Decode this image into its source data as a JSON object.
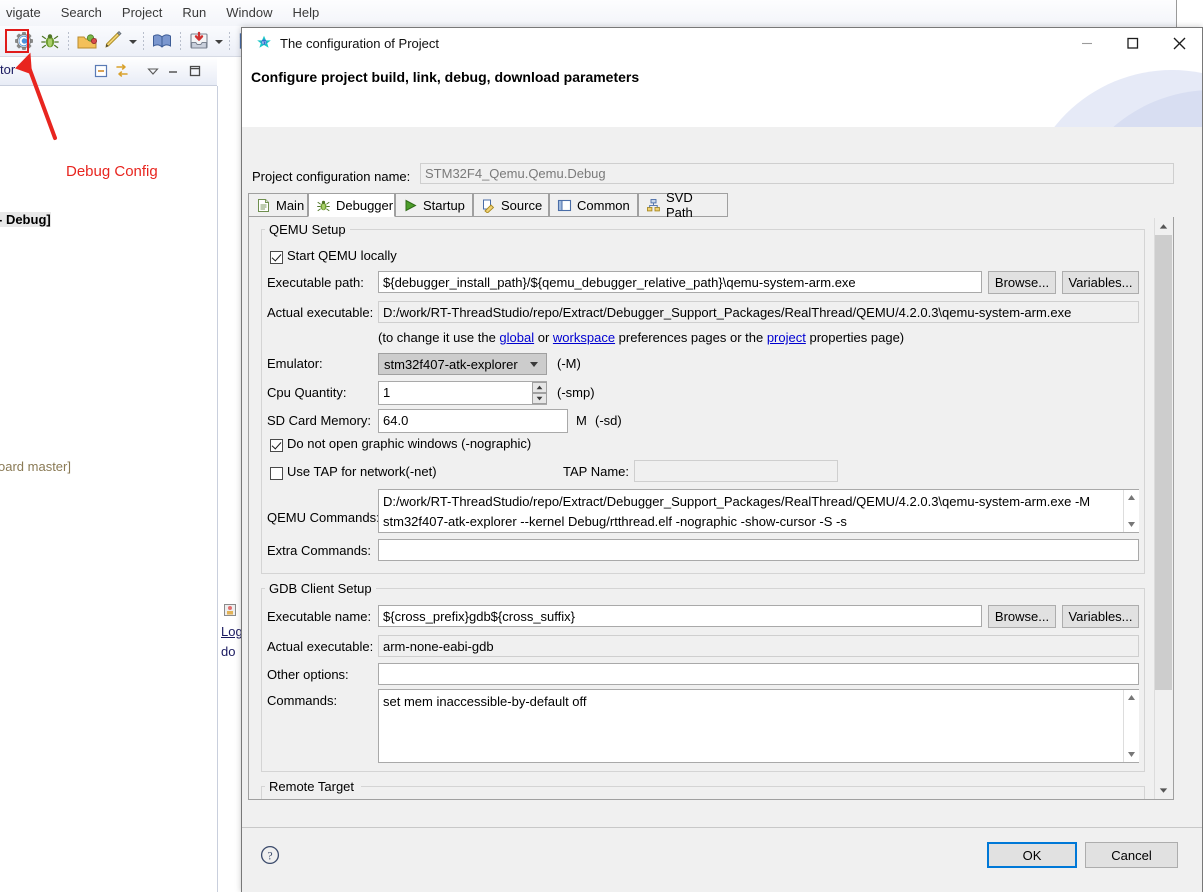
{
  "ide": {
    "menus": [
      "vigate",
      "Search",
      "Project",
      "Run",
      "Window",
      "Help"
    ],
    "toolbar_icons": [
      "debug-config-icon",
      "bug-icon",
      "open-folder-icon",
      "pencil-icon",
      "dropdown-arrow",
      "book-icon",
      "download-icon",
      "dropdown-arrow-2",
      "console-icon",
      "back-arrow-icon"
    ],
    "view_title": "tor",
    "view_icons": [
      "collapse-all-icon",
      "link-editor-icon",
      "view-menu-icon",
      "minimize-icon",
      "maximize-icon"
    ],
    "tree_items": [
      "- Debug]",
      "oard master]"
    ],
    "bottom_tab_label": "Log",
    "bottom_tab_sub": "do",
    "annotation": {
      "text": "Debug Config",
      "color": "#e8251f"
    }
  },
  "dialog": {
    "title": "The configuration of Project",
    "subtitle": "Configure project build, link, debug, download parameters",
    "window_buttons": [
      "minimize",
      "maximize",
      "close"
    ],
    "config_name": {
      "label": "Project configuration name:",
      "value": "STM32F4_Qemu.Qemu.Debug"
    },
    "tabs": [
      {
        "label": "Main",
        "icon": "document-icon",
        "active": false
      },
      {
        "label": "Debugger",
        "icon": "bug-icon",
        "active": true
      },
      {
        "label": "Startup",
        "icon": "play-icon",
        "active": false
      },
      {
        "label": "Source",
        "icon": "source-icon",
        "active": false
      },
      {
        "label": "Common",
        "icon": "common-icon",
        "active": false
      },
      {
        "label": "SVD Path",
        "icon": "svd-icon",
        "active": false
      }
    ],
    "qemu_setup": {
      "title": "QEMU Setup",
      "start_locally": {
        "label": "Start QEMU locally",
        "checked": true
      },
      "executable_path": {
        "label": "Executable path:",
        "value": "${debugger_install_path}/${qemu_debugger_relative_path}\\qemu-system-arm.exe",
        "browse": "Browse...",
        "variables": "Variables..."
      },
      "actual_executable": {
        "label": "Actual executable:",
        "value": "D:/work/RT-ThreadStudio/repo/Extract/Debugger_Support_Packages/RealThread/QEMU/4.2.0.3\\qemu-system-arm.exe"
      },
      "hint": {
        "pre": "(to change it use the ",
        "link1": "global",
        "mid1": " or ",
        "link2": "workspace",
        "mid2": " preferences pages or the ",
        "link3": "project",
        "post": " properties page)"
      },
      "emulator": {
        "label": "Emulator:",
        "value": "stm32f407-atk-explorer",
        "suffix": "(-M)"
      },
      "cpu_quantity": {
        "label": "Cpu Quantity:",
        "value": "1",
        "suffix": "(-smp)"
      },
      "sd_card_memory": {
        "label": "SD Card Memory:",
        "value": "64.0",
        "unit": "M",
        "suffix": "(-sd)"
      },
      "nographic": {
        "label": "Do not open graphic windows (-nographic)",
        "checked": true
      },
      "use_tap": {
        "label": "Use TAP for network(-net)",
        "checked": false
      },
      "tap_name": {
        "label": "TAP Name:",
        "value": ""
      },
      "qemu_commands": {
        "label": "QEMU Commands:",
        "value": "D:/work/RT-ThreadStudio/repo/Extract/Debugger_Support_Packages/RealThread/QEMU/4.2.0.3\\qemu-system-arm.exe -M stm32f407-atk-explorer --kernel Debug/rtthread.elf -nographic -show-cursor -S -s"
      },
      "extra_commands": {
        "label": "Extra Commands:",
        "value": ""
      }
    },
    "gdb_client_setup": {
      "title": "GDB Client Setup",
      "executable_name": {
        "label": "Executable name:",
        "value": "${cross_prefix}gdb${cross_suffix}",
        "browse": "Browse...",
        "variables": "Variables..."
      },
      "actual_executable": {
        "label": "Actual executable:",
        "value": "arm-none-eabi-gdb"
      },
      "other_options": {
        "label": "Other options:",
        "value": ""
      },
      "commands": {
        "label": "Commands:",
        "value": "set mem inaccessible-by-default off"
      }
    },
    "remote_target": {
      "title": "Remote Target"
    },
    "footer": {
      "help_icon": "help-icon",
      "ok": "OK",
      "cancel": "Cancel"
    },
    "colors": {
      "accent": "#0078d7",
      "link": "#0000d0",
      "dialog_bg": "#f0f0f0",
      "annotation_red": "#e8251f"
    }
  }
}
